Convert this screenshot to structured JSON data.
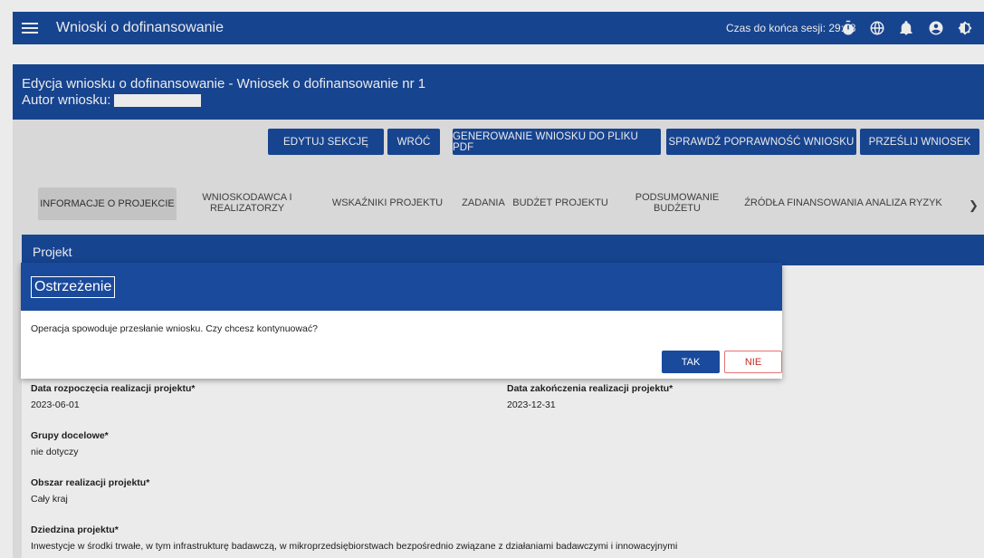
{
  "header": {
    "title": "Wnioski o dofinansowanie",
    "session_label": "Czas do końca sesji: 29:28"
  },
  "page_header": {
    "title": "Edycja wniosku o dofinansowanie - Wniosek o dofinansowanie nr 1",
    "author_label": "Autor wniosku:"
  },
  "actions": {
    "edit_section": "EDYTUJ SEKCJĘ",
    "back": "WRÓĆ",
    "generate_pdf": "GENEROWANIE WNIOSKU DO PLIKU PDF",
    "validate": "SPRAWDŹ POPRAWNOŚĆ WNIOSKU",
    "submit": "PRZEŚLIJ WNIOSEK"
  },
  "tabs": [
    {
      "label": "INFORMACJE O PROJEKCIE"
    },
    {
      "label": "WNIOSKODAWCA I REALIZATORZY"
    },
    {
      "label": "WSKAŹNIKI PROJEKTU"
    },
    {
      "label": "ZADANIA"
    },
    {
      "label": "BUDŻET PROJEKTU"
    },
    {
      "label": "PODSUMOWANIE BUDŻETU"
    },
    {
      "label": "ŹRÓDŁA FINANSOWANIA"
    },
    {
      "label": "ANALIZA RYZYK"
    }
  ],
  "card": {
    "title": "Projekt",
    "fields": {
      "start_label": "Data rozpoczęcia realizacji projektu*",
      "start_value": "2023-06-01",
      "end_label": "Data zakończenia realizacji projektu*",
      "end_value": "2023-12-31",
      "groups_label": "Grupy docelowe*",
      "groups_value": "nie dotyczy",
      "area_label": "Obszar realizacji projektu*",
      "area_value": "Cały kraj",
      "domain_label": "Dziedzina projektu*",
      "domain_value": "Inwestycje w środki trwałe, w tym infrastrukturę badawczą, w mikroprzedsiębiorstwach bezpośrednio związane z działaniami badawczymi i innowacyjnymi"
    }
  },
  "dialog": {
    "title": "Ostrzeżenie",
    "message": "Operacja spowoduje przesłanie wniosku. Czy chcesz kontynuować?",
    "yes_label": "TAK",
    "no_label": "NIE"
  },
  "colors": {
    "primary": "#1a4a9c",
    "danger": "#c62828"
  }
}
